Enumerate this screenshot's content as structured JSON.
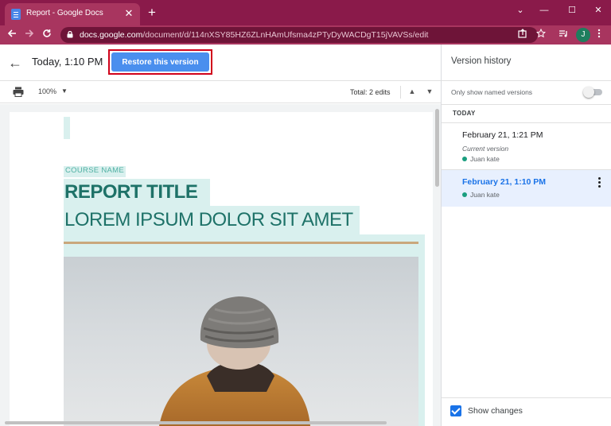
{
  "browser": {
    "tab_title": "Report - Google Docs",
    "tab_close": "✕",
    "new_tab": "+",
    "url_domain": "docs.google.com",
    "url_path": "/document/d/114nXSY85HZ6ZLnHAmUfsma4zPTyDyWACDgT15jVAVSs/edit",
    "avatar_letter": "J",
    "window_controls": [
      "⌄",
      "—",
      "☐",
      "✕"
    ],
    "accent_color": "#8a1a4a"
  },
  "doc_header": {
    "back_label": "←",
    "time": "Today, 1:10 PM",
    "restore_label": "Restore this version"
  },
  "toolbar": {
    "zoom": "100%",
    "zoom_caret": "▼",
    "edits": "Total: 2 edits",
    "prev": "▲",
    "next": "▼"
  },
  "document": {
    "course_name": "COURSE NAME",
    "report_title": "REPORT TITLE",
    "subtitle": "LOREM IPSUM DOLOR SIT AMET"
  },
  "version_history": {
    "title": "Version history",
    "named_only_label": "Only show named versions",
    "named_only_on": false,
    "section_today": "TODAY",
    "versions": [
      {
        "date": "February 21, 1:21 PM",
        "note": "Current version",
        "user": "Juan kate",
        "selected": false
      },
      {
        "date": "February 21, 1:10 PM",
        "note": "",
        "user": "Juan kate",
        "selected": true
      }
    ],
    "show_changes_label": "Show changes",
    "show_changes_checked": true
  }
}
